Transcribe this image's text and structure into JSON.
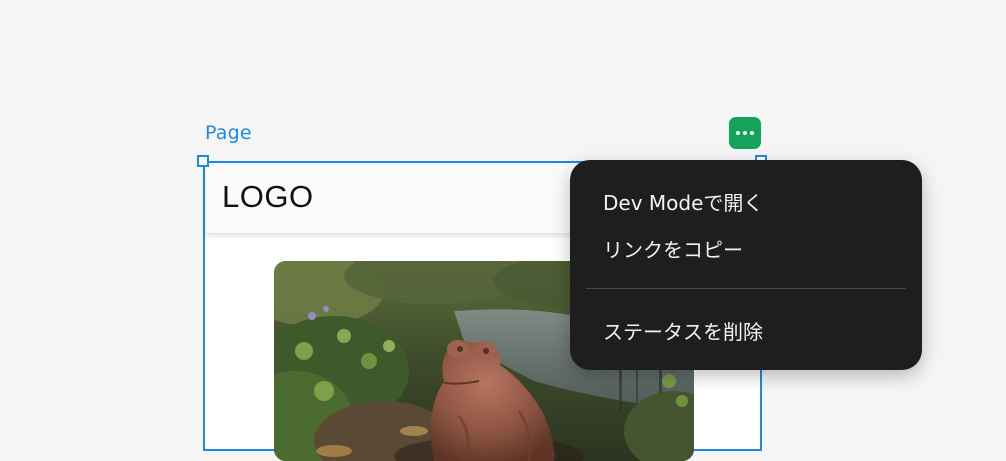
{
  "canvas": {
    "frame_label": "Page"
  },
  "frame": {
    "logo_text": "LOGO",
    "image_alt": "Frog statue by a forest stream"
  },
  "context_menu": {
    "items": [
      {
        "label": "Dev Modeで開く"
      },
      {
        "label": "リンクをコピー"
      },
      {
        "label": "ステータスを削除"
      }
    ]
  },
  "colors": {
    "selection": "#1b8be6",
    "status_button": "#14a35a",
    "menu_bg": "#1e1e1e"
  },
  "icons": {
    "status_button": "more-dots-icon"
  }
}
